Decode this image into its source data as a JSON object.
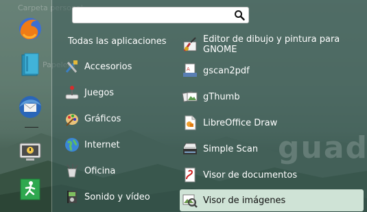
{
  "desktop": {
    "label_top": "Carpeta personal",
    "label_mid": "Papelera",
    "watermark": "guadal"
  },
  "search": {
    "value": "",
    "placeholder": ""
  },
  "categories_title": "Todas las aplicaciones",
  "categories": [
    {
      "label": "Accesorios",
      "icon": "accessories-icon"
    },
    {
      "label": "Juegos",
      "icon": "games-icon"
    },
    {
      "label": "Gráficos",
      "icon": "graphics-icon"
    },
    {
      "label": "Internet",
      "icon": "internet-icon"
    },
    {
      "label": "Oficina",
      "icon": "office-icon"
    },
    {
      "label": "Sonido y vídeo",
      "icon": "sound-video-icon"
    }
  ],
  "apps": [
    {
      "label": "Editor de dibujo y pintura para GNOME",
      "icon": "gnome-paint-icon"
    },
    {
      "label": "gscan2pdf",
      "icon": "gscan2pdf-icon"
    },
    {
      "label": "gThumb",
      "icon": "gthumb-icon"
    },
    {
      "label": "LibreOffice Draw",
      "icon": "libreoffice-draw-icon"
    },
    {
      "label": "Simple Scan",
      "icon": "simple-scan-icon"
    },
    {
      "label": "Visor de documentos",
      "icon": "document-viewer-icon"
    },
    {
      "label": "Visor de imágenes",
      "icon": "image-viewer-icon",
      "selected": true
    }
  ],
  "dock": [
    {
      "name": "firefox-icon"
    },
    {
      "name": "files-icon"
    },
    {
      "name": "thunderbird-icon"
    },
    {
      "name": "lock-screen-icon"
    },
    {
      "name": "logout-icon"
    }
  ],
  "colors": {
    "selected_bg": "#cfe3d6",
    "menu_bg": "#38544e"
  }
}
